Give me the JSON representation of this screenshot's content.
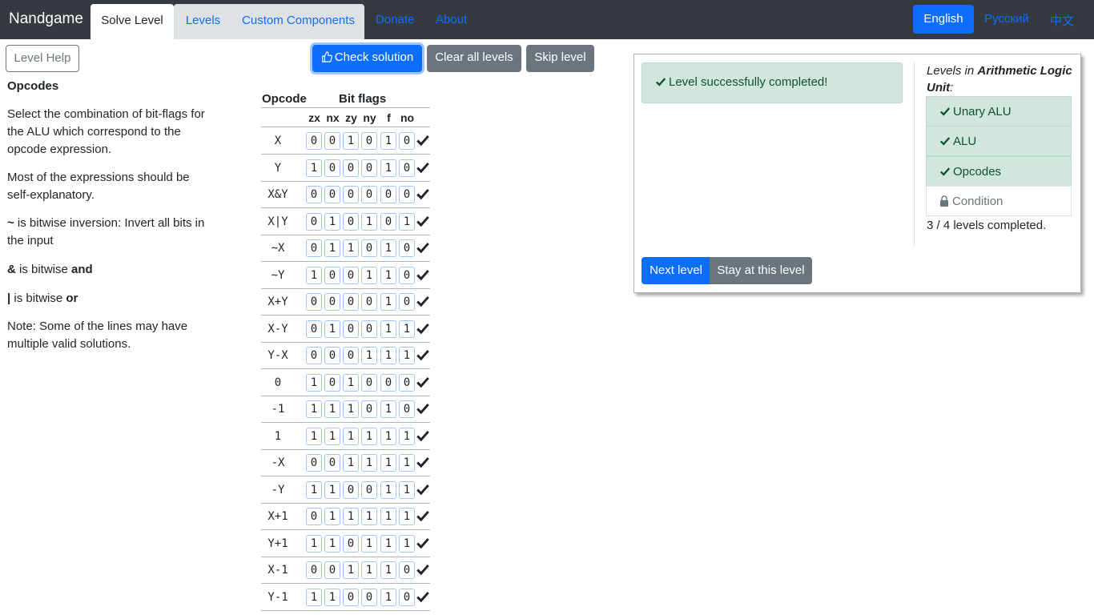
{
  "navbar": {
    "brand": "Nandgame",
    "tabs": [
      "Solve Level",
      "Levels",
      "Custom Components"
    ],
    "links": [
      "Donate",
      "About"
    ],
    "languages": [
      "English",
      "Русский",
      "中文"
    ]
  },
  "help": {
    "button": "Level Help",
    "title": "Opcodes",
    "p1": "Select the combination of bit-flags for the ALU which correspond to the opcode expression.",
    "p2": "Most of the expressions should be self-explanatory.",
    "p3_sym": "~",
    "p3_text": " is bitwise inversion: Invert all bits in the input",
    "p4_sym": "&",
    "p4_text": " is bitwise ",
    "p4_bold": "and",
    "p5_sym": "|",
    "p5_text": " is bitwise ",
    "p5_bold": "or",
    "p6": "Note: Some of the lines may have multiple valid solutions."
  },
  "actions": {
    "check": "Check solution",
    "clear": "Clear all levels",
    "skip": "Skip level"
  },
  "table": {
    "opcode_header": "Opcode",
    "flags_header": "Bit flags",
    "flag_names": [
      "zx",
      "nx",
      "zy",
      "ny",
      "f",
      "no"
    ],
    "rows": [
      {
        "op": "X",
        "bits": [
          "0",
          "0",
          "1",
          "0",
          "1",
          "0"
        ]
      },
      {
        "op": "Y",
        "bits": [
          "1",
          "0",
          "0",
          "0",
          "1",
          "0"
        ]
      },
      {
        "op": "X&Y",
        "bits": [
          "0",
          "0",
          "0",
          "0",
          "0",
          "0"
        ]
      },
      {
        "op": "X|Y",
        "bits": [
          "0",
          "1",
          "0",
          "1",
          "0",
          "1"
        ]
      },
      {
        "op": "~X",
        "bits": [
          "0",
          "1",
          "1",
          "0",
          "1",
          "0"
        ]
      },
      {
        "op": "~Y",
        "bits": [
          "1",
          "0",
          "0",
          "1",
          "1",
          "0"
        ]
      },
      {
        "op": "X+Y",
        "bits": [
          "0",
          "0",
          "0",
          "0",
          "1",
          "0"
        ]
      },
      {
        "op": "X-Y",
        "bits": [
          "0",
          "1",
          "0",
          "0",
          "1",
          "1"
        ]
      },
      {
        "op": "Y-X",
        "bits": [
          "0",
          "0",
          "0",
          "1",
          "1",
          "1"
        ]
      },
      {
        "op": "0",
        "bits": [
          "1",
          "0",
          "1",
          "0",
          "0",
          "0"
        ]
      },
      {
        "op": "-1",
        "bits": [
          "1",
          "1",
          "1",
          "0",
          "1",
          "0"
        ]
      },
      {
        "op": "1",
        "bits": [
          "1",
          "1",
          "1",
          "1",
          "1",
          "1"
        ]
      },
      {
        "op": "-X",
        "bits": [
          "0",
          "0",
          "1",
          "1",
          "1",
          "1"
        ]
      },
      {
        "op": "-Y",
        "bits": [
          "1",
          "1",
          "0",
          "0",
          "1",
          "1"
        ]
      },
      {
        "op": "X+1",
        "bits": [
          "0",
          "1",
          "1",
          "1",
          "1",
          "1"
        ]
      },
      {
        "op": "Y+1",
        "bits": [
          "1",
          "1",
          "0",
          "1",
          "1",
          "1"
        ]
      },
      {
        "op": "X-1",
        "bits": [
          "0",
          "0",
          "1",
          "1",
          "1",
          "0"
        ]
      },
      {
        "op": "Y-1",
        "bits": [
          "1",
          "1",
          "0",
          "0",
          "1",
          "0"
        ]
      }
    ]
  },
  "result": {
    "success": "Level successfully completed!",
    "levels_prefix": "Levels in ",
    "levels_group": "Arithmetic Logic Unit",
    "levels_suffix": ":",
    "levels": [
      {
        "name": "Unary ALU",
        "state": "done"
      },
      {
        "name": "ALU",
        "state": "done"
      },
      {
        "name": "Opcodes",
        "state": "done"
      },
      {
        "name": "Condition",
        "state": "locked"
      }
    ],
    "count": "3 / 4 levels completed.",
    "next": "Next level",
    "stay": "Stay at this level"
  },
  "colors": {
    "navbar": "#343a40",
    "primary": "#0d6efd",
    "secondary": "#6c757d",
    "success_bg": "#d1e7dd",
    "success_text": "#0f5132"
  }
}
